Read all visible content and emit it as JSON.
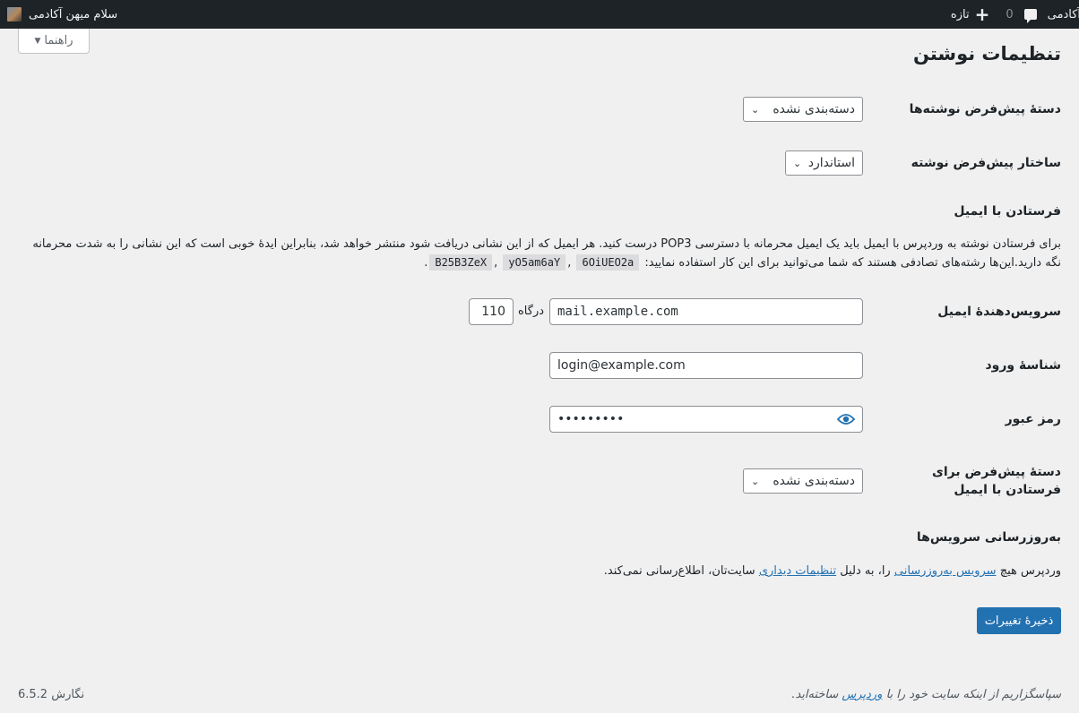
{
  "adminbar": {
    "greeting": "سلام میهن آکادمی",
    "new_label": "تازه",
    "comment_count": "0",
    "site_name": "آکادمی"
  },
  "help_tab": {
    "label": "راهنما"
  },
  "page_title": "تنظیمات نوشتن",
  "fields": {
    "default_category": {
      "label": "دستهٔ پیش‌فرض نوشته‌ها",
      "value": "دسته‌بندی نشده"
    },
    "default_format": {
      "label": "ساختار پیش‌فرض نوشته",
      "value": "استاندارد"
    }
  },
  "post_via_email": {
    "heading": "فرستادن با ایمیل",
    "description": "برای فرستادن نوشته به وردپرس با ایمیل باید یک ایمیل محرمانه با دسترسی POP3 درست کنید. هر ایمیل که از این نشانی دریافت شود منتشر خواهد شد، بنابراین ایدهٔ خوبی است که این نشانی را به شدت محرمانه نگه دارید.این‌ها رشته‌های تصادفی هستند که شما می‌توانید برای این کار استفاده نمایید:",
    "codes": [
      "B25B3ZeX",
      "yO5am6aY",
      "6OiUEO2a"
    ],
    "mail_server": {
      "label": "سرویس‌دهندهٔ ایمیل",
      "value": "mail.example.com",
      "port_label": "درگاه",
      "port": "110"
    },
    "login": {
      "label": "شناسهٔ ورود",
      "value": "login@example.com"
    },
    "password": {
      "label": "رمز عبور",
      "value": "•••••••••"
    },
    "email_category": {
      "label": "دستهٔ پیش‌فرض برای فرستادن با ایمیل",
      "value": "دسته‌بندی نشده"
    }
  },
  "update_services": {
    "heading": "به‌روزرسانی سرویس‌ها",
    "text_before": "وردپرس هیچ",
    "link1": "سرویس به‌روزرسانی",
    "text_middle": "را، به دلیل",
    "link2": "تنظیمات دیداری",
    "text_after": "سایت‌تان، اطلاع‌رسانی نمی‌کند."
  },
  "save_button": "ذخیرهٔ تغییرات",
  "footer": {
    "thanks_before": "سپاسگزاریم از اینکه سایت خود را با",
    "thanks_link": "وردپرس",
    "thanks_after": "ساخته‌اید.",
    "version": "نگارش 6.5.2"
  },
  "colors": {
    "primary": "#2271b1",
    "adminbar": "#1d2327",
    "background": "#f0f0f1"
  }
}
